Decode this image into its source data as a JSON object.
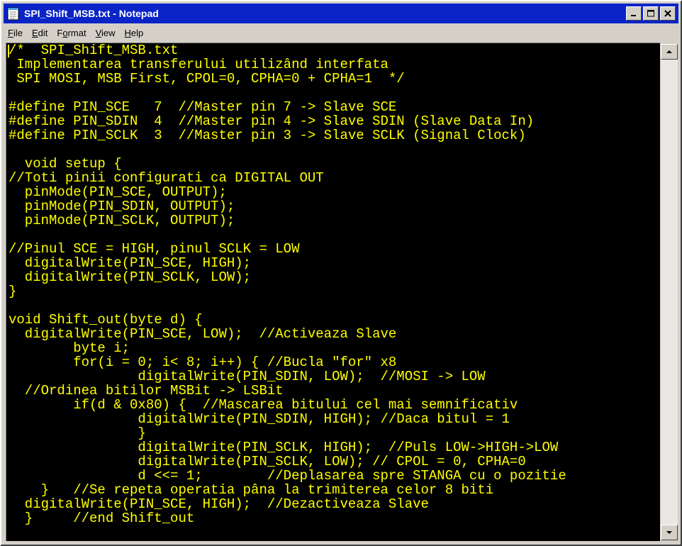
{
  "window": {
    "title": "SPI_Shift_MSB.txt - Notepad"
  },
  "menu": {
    "file": {
      "mnemonic": "F",
      "rest": "ile"
    },
    "edit": {
      "mnemonic": "E",
      "rest": "dit"
    },
    "format": {
      "mnemonic": "o",
      "pre": "F",
      "rest": "rmat"
    },
    "view": {
      "mnemonic": "V",
      "rest": "iew"
    },
    "help": {
      "mnemonic": "H",
      "rest": "elp"
    }
  },
  "icons": {
    "app": "notepad-icon",
    "minimize": "minimize-icon",
    "maximize": "maximize-icon",
    "close": "close-icon",
    "scroll_up": "scroll-up-arrow-icon",
    "scroll_down": "scroll-down-arrow-icon"
  },
  "colors": {
    "text": "#ffff00",
    "background": "#000000",
    "titlebar": "#0a24c8"
  },
  "editor": {
    "lines": [
      "/*  SPI_Shift_MSB.txt",
      " Implementarea transferului utilizând interfata",
      " SPI MOSI, MSB First, CPOL=0, CPHA=0 + CPHA=1  */",
      "",
      "#define PIN_SCE   7  //Master pin 7 -> Slave SCE",
      "#define PIN_SDIN  4  //Master pin 4 -> Slave SDIN (Slave Data In)",
      "#define PIN_SCLK  3  //Master pin 3 -> Slave SCLK (Signal Clock)",
      "",
      "  void setup {",
      "//Toti pinii configurati ca DIGITAL OUT",
      "  pinMode(PIN_SCE, OUTPUT);",
      "  pinMode(PIN_SDIN, OUTPUT);",
      "  pinMode(PIN_SCLK, OUTPUT);",
      "",
      "//Pinul SCE = HIGH, pinul SCLK = LOW",
      "  digitalWrite(PIN_SCE, HIGH);",
      "  digitalWrite(PIN_SCLK, LOW);",
      "}",
      "",
      "void Shift_out(byte d) {",
      "  digitalWrite(PIN_SCE, LOW);  //Activeaza Slave",
      "        byte i;",
      "        for(i = 0; i< 8; i++) { //Bucla \"for\" x8",
      "                digitalWrite(PIN_SDIN, LOW);  //MOSI -> LOW",
      "  //Ordinea bitilor MSBit -> LSBit",
      "        if(d & 0x80) {  //Mascarea bitului cel mai semnificativ",
      "                digitalWrite(PIN_SDIN, HIGH); //Daca bitul = 1",
      "                }",
      "                digitalWrite(PIN_SCLK, HIGH);  //Puls LOW->HIGH->LOW",
      "                digitalWrite(PIN_SCLK, LOW); // CPOL = 0, CPHA=0",
      "                d <<= 1;        //Deplasarea spre STANGA cu o pozitie",
      "    }   //Se repeta operatia pâna la trimiterea celor 8 biti",
      "  digitalWrite(PIN_SCE, HIGH);  //Dezactiveaza Slave",
      "  }     //end Shift_out"
    ]
  }
}
